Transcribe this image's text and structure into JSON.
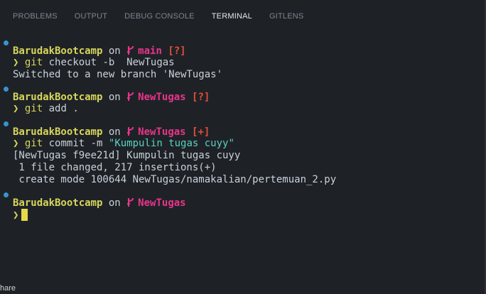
{
  "panel": {
    "tabs": [
      {
        "label": "PROBLEMS"
      },
      {
        "label": "OUTPUT"
      },
      {
        "label": "DEBUG CONSOLE"
      },
      {
        "label": "TERMINAL"
      },
      {
        "label": "GITLENS"
      }
    ],
    "active_tab": "TERMINAL"
  },
  "terminal": {
    "user": "BarudakBootcamp",
    "on": "on",
    "prompt_symbol": "❯",
    "blocks": [
      {
        "branch": "main",
        "status": "[?]",
        "command": {
          "git": "git",
          "rest": " checkout -b  NewTugas"
        },
        "output": [
          "Switched to a new branch 'NewTugas'"
        ]
      },
      {
        "branch": "NewTugas",
        "status": "[?]",
        "command": {
          "git": "git",
          "rest": " add ."
        },
        "output": []
      },
      {
        "branch": "NewTugas",
        "status": "[+]",
        "command": {
          "git": "git",
          "rest": " commit -m ",
          "string": "\"Kumpulin tugas cuyy\""
        },
        "output": [
          "[NewTugas f9ee21d] Kumpulin tugas cuyy",
          " 1 file changed, 217 insertions(+)",
          " create mode 100644 NewTugas/namakalian/pertemuan_2.py"
        ]
      },
      {
        "branch": "NewTugas",
        "status": ""
      }
    ]
  },
  "statusbar": {
    "partial_text": "hare"
  },
  "colors": {
    "background": "#1e2227",
    "user": "#d8d65a",
    "branch": "#e9348a",
    "status": "#e44d3a",
    "string": "#5ad1c1",
    "dot": "#3794d1"
  }
}
